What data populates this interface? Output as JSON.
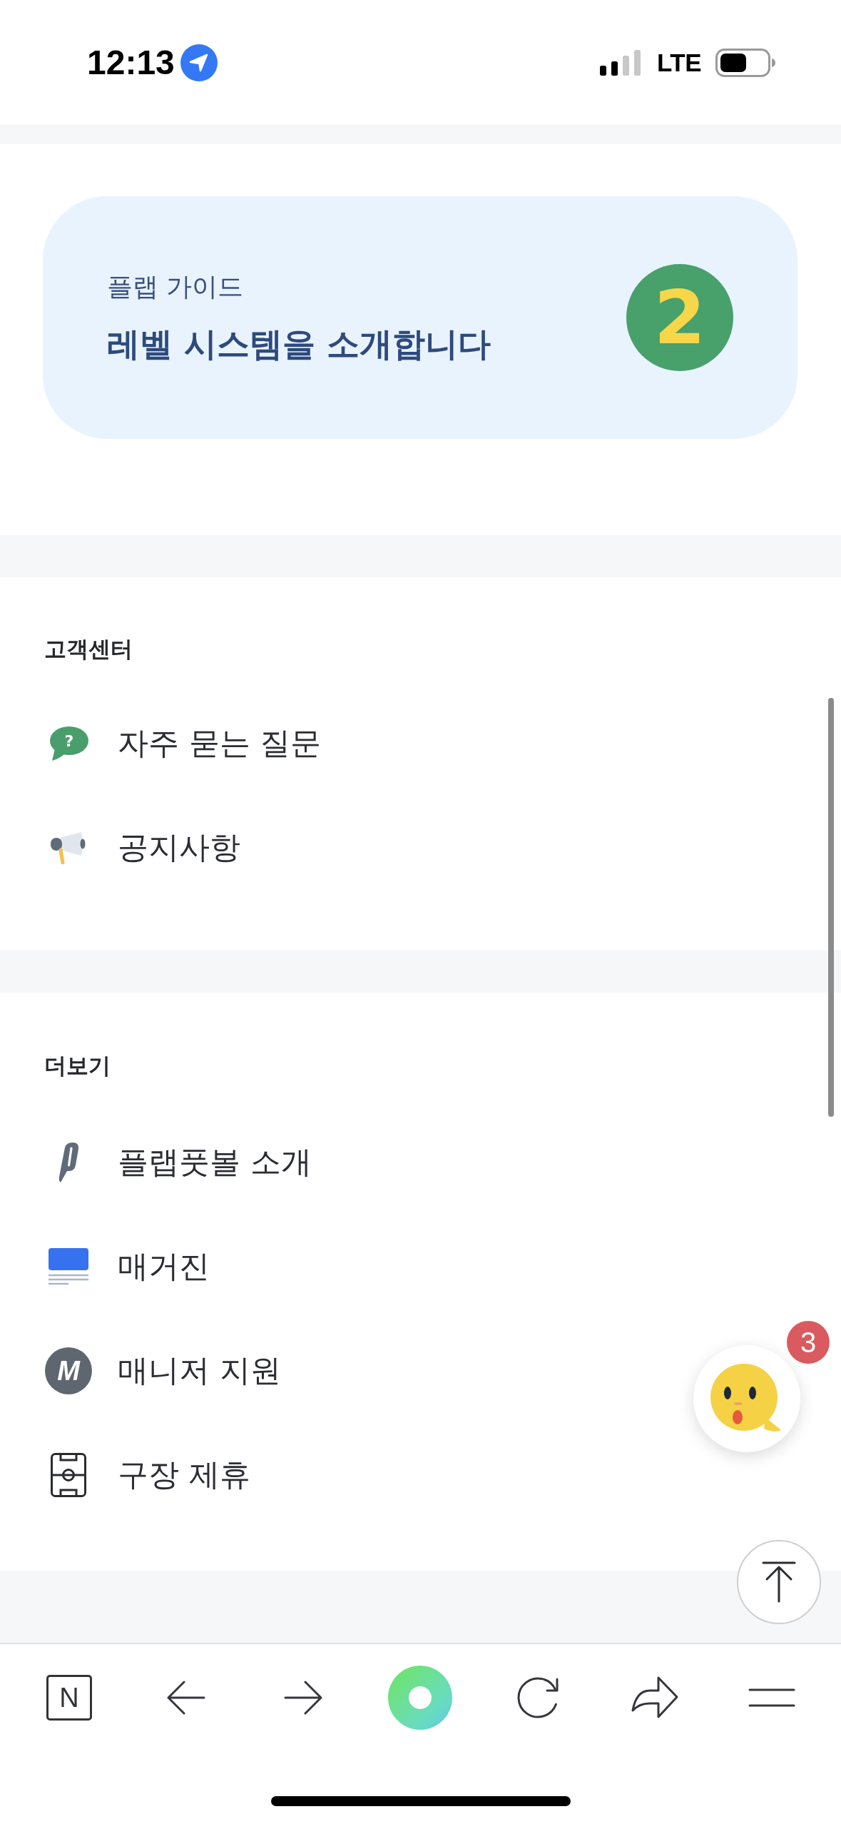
{
  "status_bar": {
    "time": "12:13",
    "network": "LTE"
  },
  "banner": {
    "eyebrow": "플랩 가이드",
    "title": "레벨 시스템을 소개합니다",
    "badge": "2"
  },
  "sections": [
    {
      "title": "고객센터",
      "items": [
        {
          "kind": "faq",
          "label": "자주 묻는 질문",
          "icon_text": "?"
        },
        {
          "kind": "notice",
          "label": "공지사항"
        }
      ]
    },
    {
      "title": "더보기",
      "items": [
        {
          "kind": "intro",
          "label": "플랩풋볼 소개"
        },
        {
          "kind": "magazine",
          "label": "매거진"
        },
        {
          "kind": "manager",
          "label": "매니저 지원",
          "icon_text": "M"
        },
        {
          "kind": "stadium",
          "label": "구장 제휴"
        }
      ]
    }
  ],
  "chat_button": {
    "count": "3"
  },
  "browser_toolbar": [
    {
      "kind": "tabs",
      "label": "N"
    },
    {
      "kind": "back"
    },
    {
      "kind": "forward"
    },
    {
      "kind": "home"
    },
    {
      "kind": "reload"
    },
    {
      "kind": "share"
    },
    {
      "kind": "menu"
    }
  ]
}
